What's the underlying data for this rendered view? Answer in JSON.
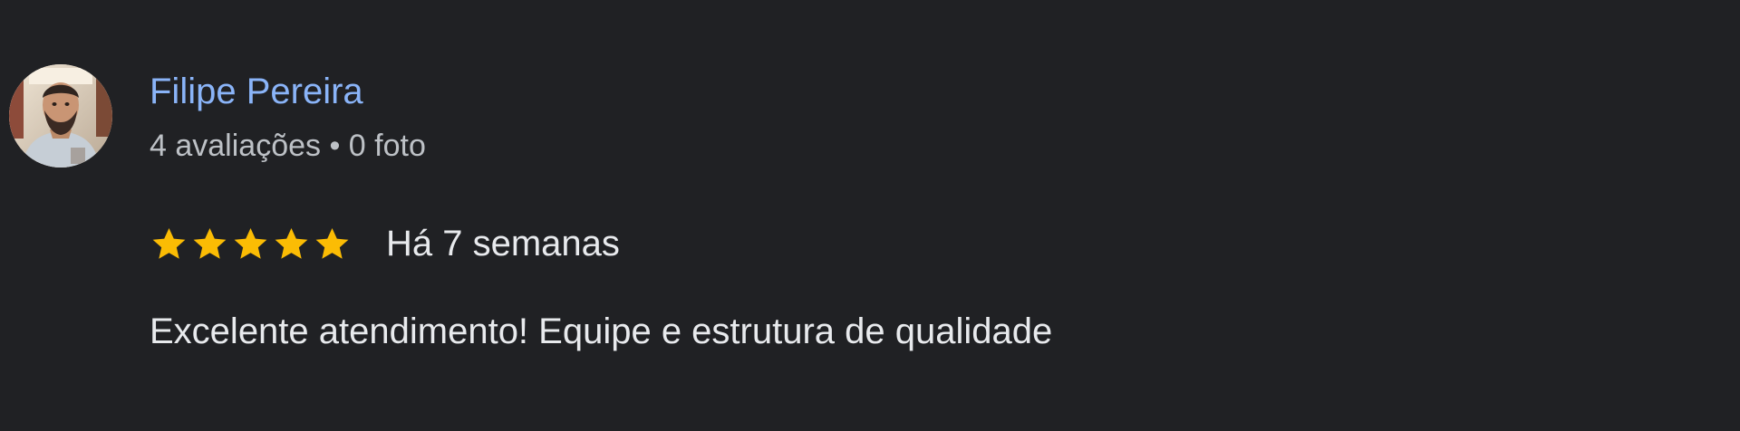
{
  "review": {
    "author": {
      "name": "Filipe Pereira",
      "meta": "4 avaliações • 0 foto",
      "avatar_icon": "profile-photo"
    },
    "rating": {
      "value": 5,
      "max": 5,
      "star_color": "#fbbc04",
      "star_icon": "star-icon"
    },
    "date": "Há 7 semanas",
    "text": "Excelente atendimento! Equipe e estrutura de qualidade"
  },
  "colors": {
    "background": "#202124",
    "author_link": "#8ab4f8",
    "primary_text": "#e8eaed",
    "secondary_text": "#bdc1c6"
  }
}
